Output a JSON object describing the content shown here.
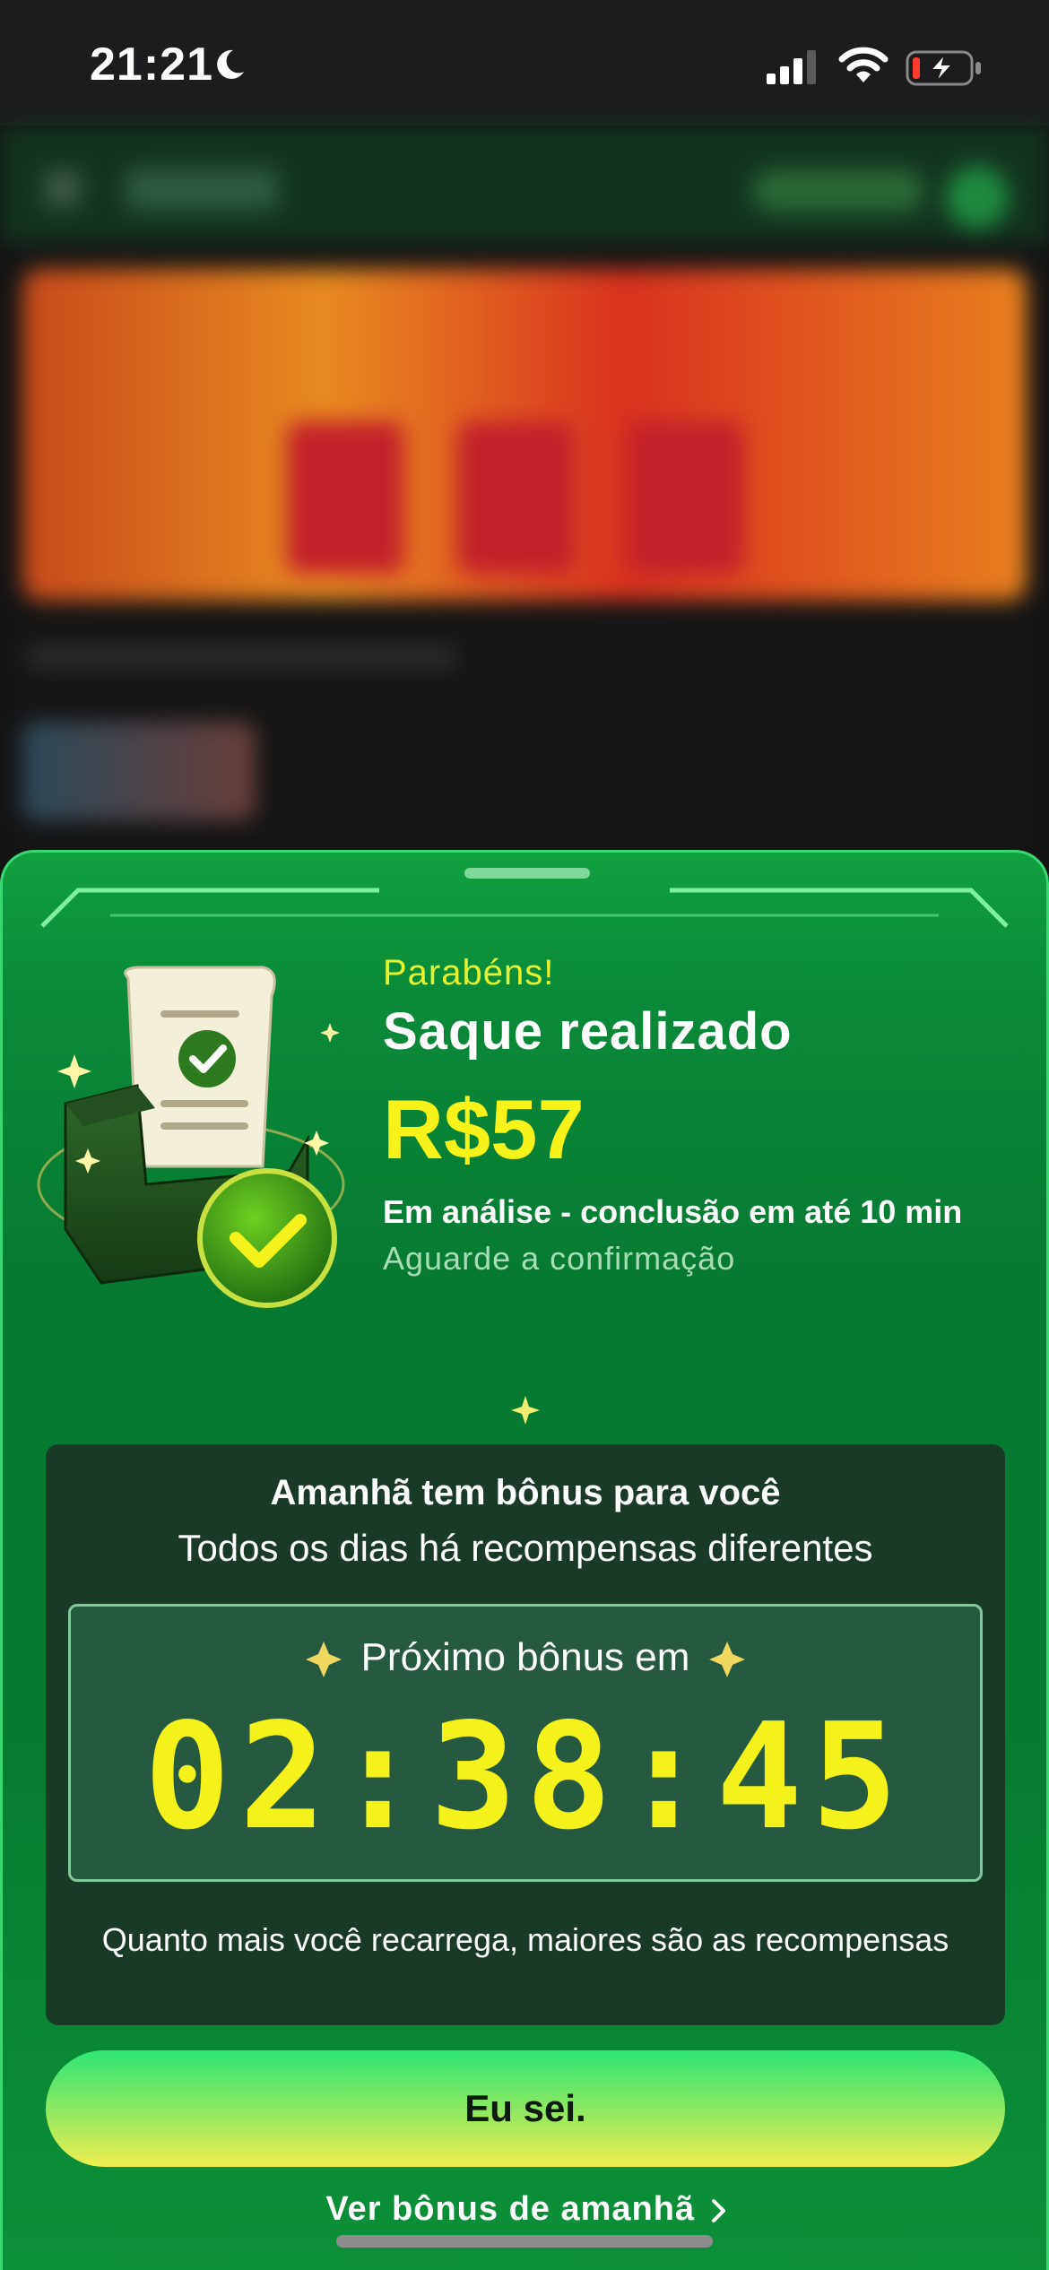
{
  "status_bar": {
    "time": "21:21"
  },
  "sheet": {
    "congrats": "Parabéns!",
    "title": "Saque realizado",
    "amount": "R$57",
    "status": "Em análise - conclusão em até 10 min",
    "subtext": "Aguarde a confirmação"
  },
  "bonus": {
    "title": "Amanhã tem bônus para você",
    "subtitle": "Todos os dias há recompensas diferentes",
    "next_label": "Próximo bônus em",
    "countdown": "02:38:45",
    "note": "Quanto mais você recarrega, maiores são as recompensas"
  },
  "actions": {
    "primary_label": "Eu sei.",
    "link_label": "Ver bônus de amanhã"
  },
  "colors": {
    "accent_yellow": "#f6f21a",
    "sheet_green": "#077a32",
    "card_dark": "#1a3a28"
  },
  "icons": [
    "moon-icon",
    "cellular-signal-icon",
    "wifi-icon",
    "battery-charging-icon",
    "wallet-receipt-check-illustration",
    "sparkle-icon",
    "chevron-right-icon"
  ]
}
